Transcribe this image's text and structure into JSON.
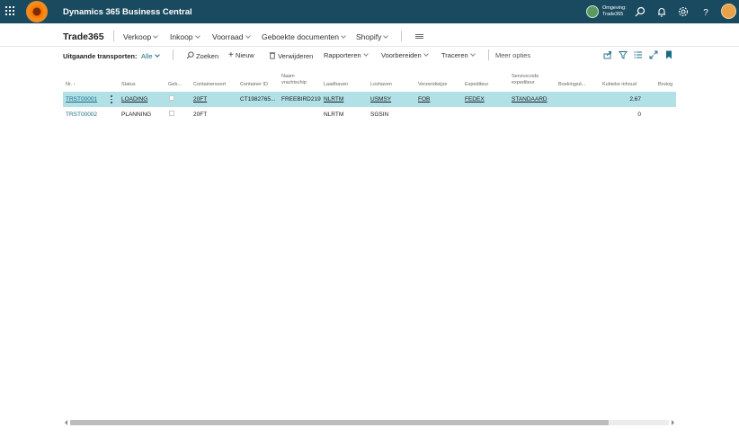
{
  "app": {
    "title": "Dynamics 365 Business Central",
    "environment_label": "Omgeving:",
    "environment_name": "Trade365"
  },
  "nav": {
    "company": "Trade365",
    "items": [
      "Verkoop",
      "Inkoop",
      "Voorraad",
      "Geboekte documenten",
      "Shopify"
    ]
  },
  "actions": {
    "page_label": "Uitgaande transporten:",
    "filter_value": "Alle",
    "search": "Zoeken",
    "new": "Nieuw",
    "delete": "Verwijderen",
    "reports": "Rapporteren",
    "prepare": "Voorbereiden",
    "trace": "Traceren",
    "more": "Meer opties"
  },
  "table": {
    "headers": {
      "nr": "Nr. ↑",
      "status": "Status",
      "geb": "Geb...",
      "containersoort": "Containersoort",
      "container_id": "Container ID",
      "naam_vrachtschip_1": "Naam",
      "naam_vrachtschip_2": "vrachtschip",
      "laadhaven": "Laadhaven",
      "loshaven": "Loshaven",
      "verzendwijze": "Verzendwijze",
      "expediteur": "Expediteur",
      "servicecode_1": "Servicecode",
      "servicecode_2": "expediteur",
      "boekingsd": "Boekingsd...",
      "kubieke_inhoud": "Kubieke inhoud",
      "bruto": "Brutog"
    },
    "rows": [
      {
        "nr": "TRST00001",
        "status": "LOADING",
        "containersoort": "20FT",
        "container_id": "CT1982765...",
        "naam_vrachtschip": "FREEBIRD219",
        "laadhaven": "NLRTM",
        "loshaven": "USMSY",
        "verzendwijze": "FOB",
        "expediteur": "FEDEX",
        "servicecode": "STANDAARD",
        "kubieke_inhoud": "2,67"
      },
      {
        "nr": "TRST00002",
        "status": "PLANNING",
        "containersoort": "20FT",
        "container_id": "",
        "naam_vrachtschip": "",
        "laadhaven": "NLRTM",
        "loshaven": "SGSIN",
        "verzendwijze": "",
        "expediteur": "",
        "servicecode": "",
        "kubieke_inhoud": "0"
      }
    ]
  },
  "scrollbar": {
    "thumb_fraction": 0.9
  },
  "colors": {
    "topbar": "#1a4a60",
    "accent": "#1c6b85",
    "selected_row": "#b1e0e6"
  }
}
